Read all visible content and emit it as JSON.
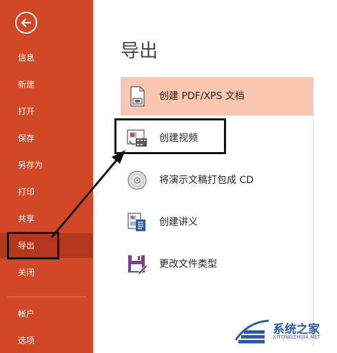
{
  "sidebar": {
    "items": [
      {
        "label": "信息"
      },
      {
        "label": "新建"
      },
      {
        "label": "打开"
      },
      {
        "label": "保存"
      },
      {
        "label": "另存为"
      },
      {
        "label": "打印"
      },
      {
        "label": "共享"
      },
      {
        "label": "导出"
      },
      {
        "label": "关闭"
      },
      {
        "label": "帐户"
      },
      {
        "label": "选项"
      }
    ],
    "active_item": "导出",
    "accent_color": "#d24726"
  },
  "main": {
    "title": "导出",
    "options": [
      {
        "label": "创建 PDF/XPS 文档",
        "icon": "pdf-document-icon"
      },
      {
        "label": "创建视频",
        "icon": "video-icon"
      },
      {
        "label": "将演示文稿打包成 CD",
        "icon": "cd-icon"
      },
      {
        "label": "创建讲义",
        "icon": "handout-icon"
      },
      {
        "label": "更改文件类型",
        "icon": "save-as-file-type-icon"
      }
    ],
    "selected_option": "创建 PDF/XPS 文档"
  },
  "watermark": {
    "name": "系统之家",
    "url": "XITONGZHIJIA.NET"
  }
}
